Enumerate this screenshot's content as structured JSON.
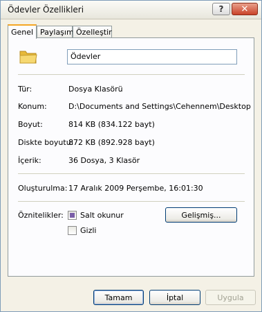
{
  "window": {
    "title": "Ödevler Özellikleri",
    "help_label": "?",
    "close_label": "✕"
  },
  "tabs": [
    {
      "label": "Genel",
      "active": true
    },
    {
      "label": "Paylaşım",
      "active": false
    },
    {
      "label": "Özelleştir",
      "active": false
    }
  ],
  "general": {
    "folder_icon": "folder-icon",
    "name_value": "Ödevler",
    "rows": [
      {
        "label": "Tür:",
        "value": "Dosya Klasörü"
      },
      {
        "label": "Konum:",
        "value": "D:\\Documents and Settings\\Cehennem\\Desktop"
      },
      {
        "label": "Boyut:",
        "value": "814 KB (834.122 bayt)"
      },
      {
        "label": "Diskte boyutu:",
        "value": "872 KB (892.928 bayt)"
      },
      {
        "label": "İçerik:",
        "value": "36 Dosya, 3 Klasör"
      }
    ],
    "created_label": "Oluşturulma:",
    "created_value": "17 Aralık 2009 Perşembe, 16:01:30",
    "attributes_label": "Öznitelikler:",
    "readonly_label": "Salt okunur",
    "readonly_state": "indeterminate",
    "hidden_label": "Gizli",
    "hidden_state": "unchecked",
    "advanced_label": "Gelişmiş..."
  },
  "buttons": {
    "ok": "Tamam",
    "cancel": "İptal",
    "apply": "Uygula"
  },
  "colors": {
    "tab_accent": "#f5a623",
    "folder": "#f3d36b",
    "close": "#c9432a"
  }
}
